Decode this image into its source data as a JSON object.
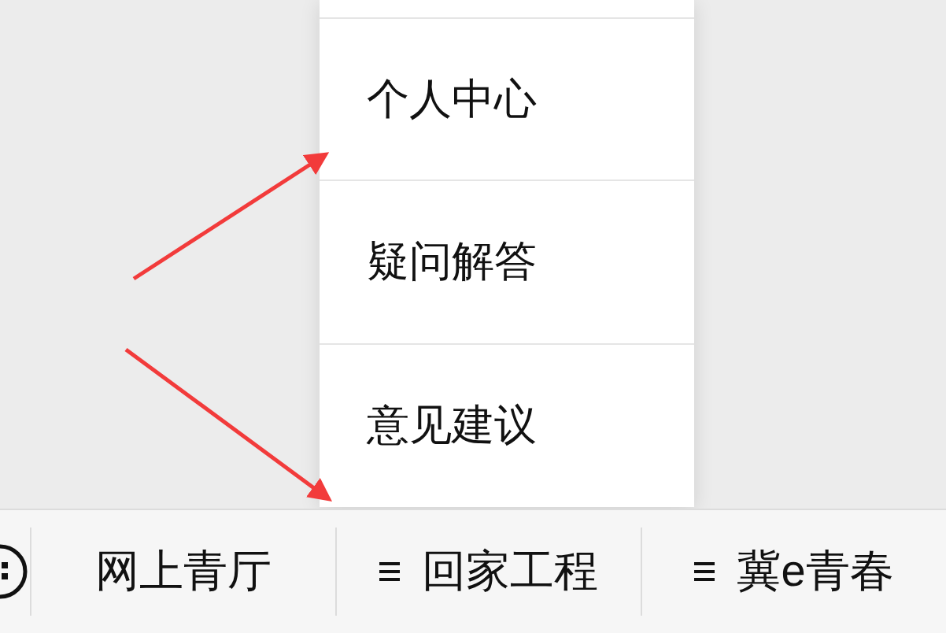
{
  "popup_menu": {
    "items": [
      {
        "label": "个人中心"
      },
      {
        "label": "疑问解答"
      },
      {
        "label": "意见建议"
      }
    ]
  },
  "bottom_bar": {
    "items": [
      {
        "kind": "link",
        "label": "网上青厅"
      },
      {
        "kind": "submenu",
        "label": "回家工程"
      },
      {
        "kind": "submenu",
        "label": "冀e青春"
      }
    ]
  }
}
